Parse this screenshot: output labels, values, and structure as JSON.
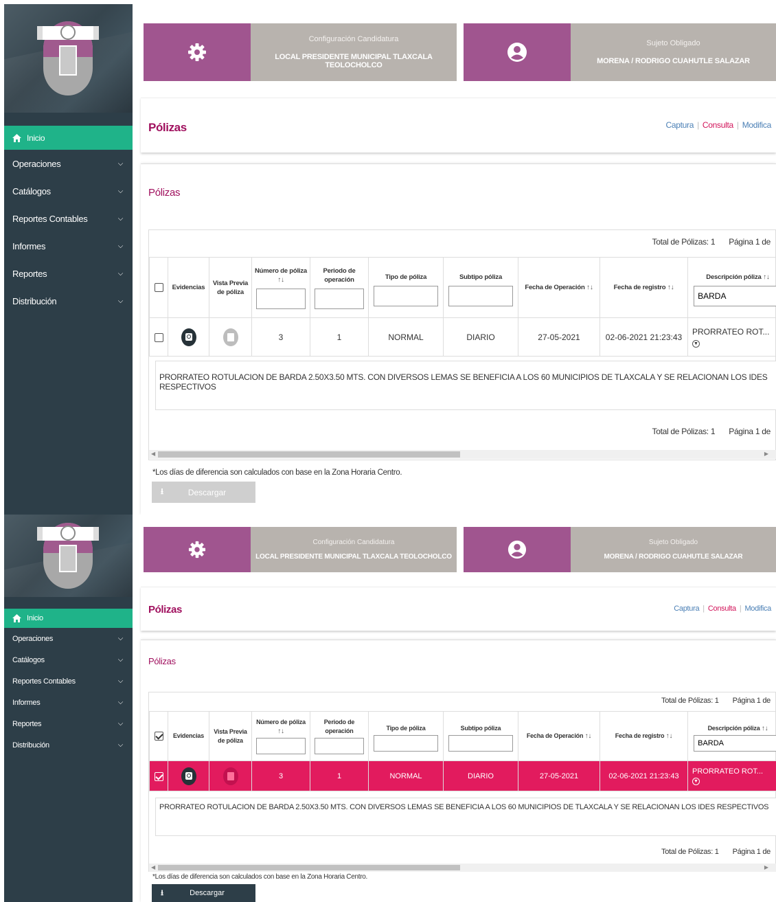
{
  "nav": {
    "items": [
      {
        "label": "Inicio"
      },
      {
        "label": "Operaciones"
      },
      {
        "label": "Catálogos"
      },
      {
        "label": "Reportes Contables"
      },
      {
        "label": "Informes"
      },
      {
        "label": "Reportes"
      },
      {
        "label": "Distribución"
      }
    ]
  },
  "cards": {
    "config": {
      "title": "Configuración Candidatura",
      "value": "LOCAL PRESIDENTE MUNICIPAL TLAXCALA TEOLOCHOLCO"
    },
    "subject": {
      "title": "Sujeto Obligado",
      "value": "MORENA / RODRIGO CUAHUTLE SALAZAR"
    }
  },
  "page": {
    "title": "Pólizas",
    "links": {
      "captura": "Captura",
      "sep": "|",
      "consulta": "Consulta",
      "modifica": "Modifica"
    },
    "section_title": "Pólizas"
  },
  "table": {
    "total_label": "Total de Pólizas: 1",
    "page_label": "Página 1 de",
    "headers": {
      "evidencias": "Evidencias",
      "vista_previa": "Vista Previa de póliza",
      "numero": "Número de póliza",
      "periodo": "Periodo de operación",
      "tipo": "Tipo de póliza",
      "subtipo": "Subtipo póliza",
      "fecha_operacion": "Fecha de Operación",
      "fecha_registro": "Fecha de registro",
      "descripcion": "Descripción póliza"
    },
    "sort_glyph": "↑↓",
    "filter_descripcion": "BARDA",
    "row": {
      "numero": "3",
      "periodo": "1",
      "tipo": "NORMAL",
      "subtipo": "DIARIO",
      "fecha_operacion": "27-05-2021",
      "fecha_registro": "02-06-2021 21:23:43",
      "descripcion": "PRORRATEO ROT..."
    },
    "expanded_description": "PRORRATEO ROTULACION DE BARDA 2.50X3.50 MTS. CON DIVERSOS LEMAS SE BENEFICIA A LOS 60 MUNICIPIOS DE TLAXCALA Y SE RELACIONAN LOS IDES RESPECTIVOS"
  },
  "footer": {
    "note": "*Los días de diferencia son calculados con base en la Zona Horaria Centro.",
    "download_label": "Descargar"
  },
  "colors": {
    "accent_purple": "#a0558f",
    "active_green": "#1fb389",
    "selected_row": "#e21b5e",
    "title_maroon": "#a0105e",
    "sidebar_bg": "#2d3e48"
  }
}
